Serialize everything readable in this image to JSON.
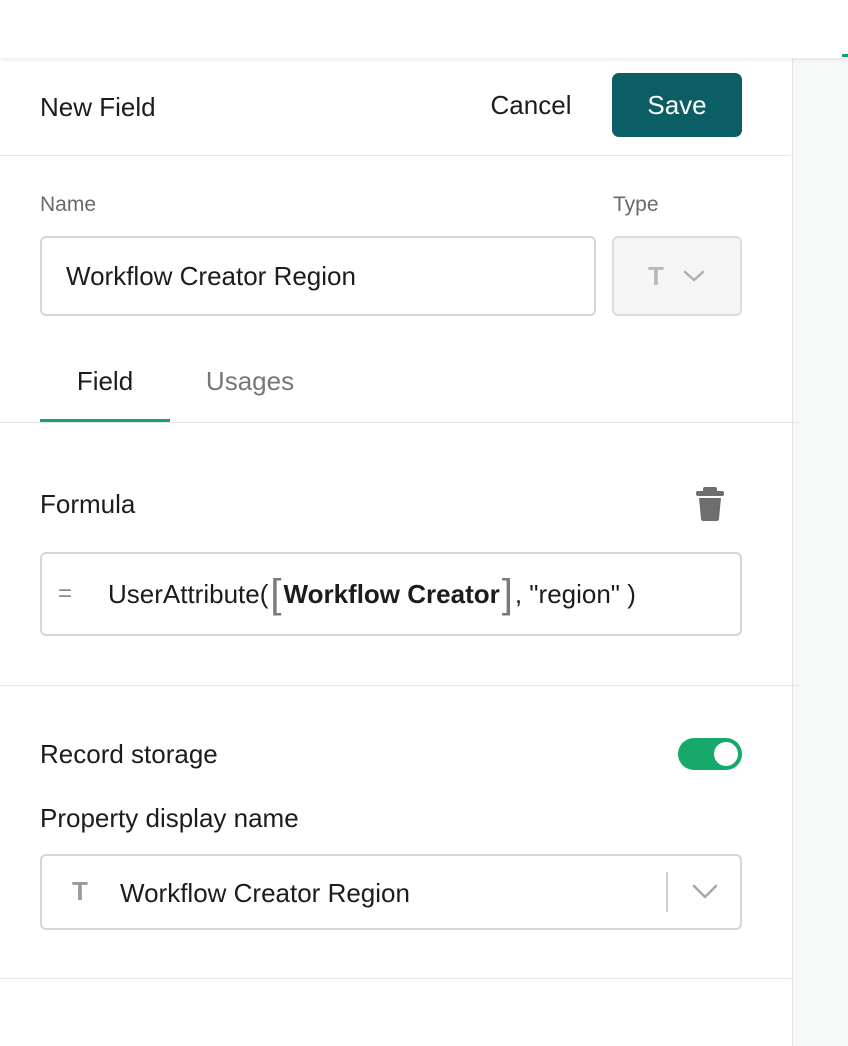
{
  "header": {
    "title": "New Field",
    "cancel_label": "Cancel",
    "save_label": "Save"
  },
  "name_field": {
    "label": "Name",
    "value": "Workflow Creator Region"
  },
  "type_field": {
    "label": "Type",
    "selected_icon": "T",
    "icon_name": "text-type-icon"
  },
  "tabs": [
    {
      "label": "Field",
      "active": true
    },
    {
      "label": "Usages",
      "active": false
    }
  ],
  "formula": {
    "title": "Formula",
    "prefix": "=",
    "function_name": "UserAttribute(",
    "argument_chip": "Workflow Creator",
    "rest": ", \"region\" )"
  },
  "record_storage": {
    "title": "Record storage",
    "enabled": true,
    "property_label": "Property display name",
    "property_icon": "T",
    "property_value": "Workflow Creator Region"
  },
  "colors": {
    "primary_button": "#0b5e63",
    "accent_green": "#1aa06d",
    "toggle_on": "#17a86b"
  }
}
